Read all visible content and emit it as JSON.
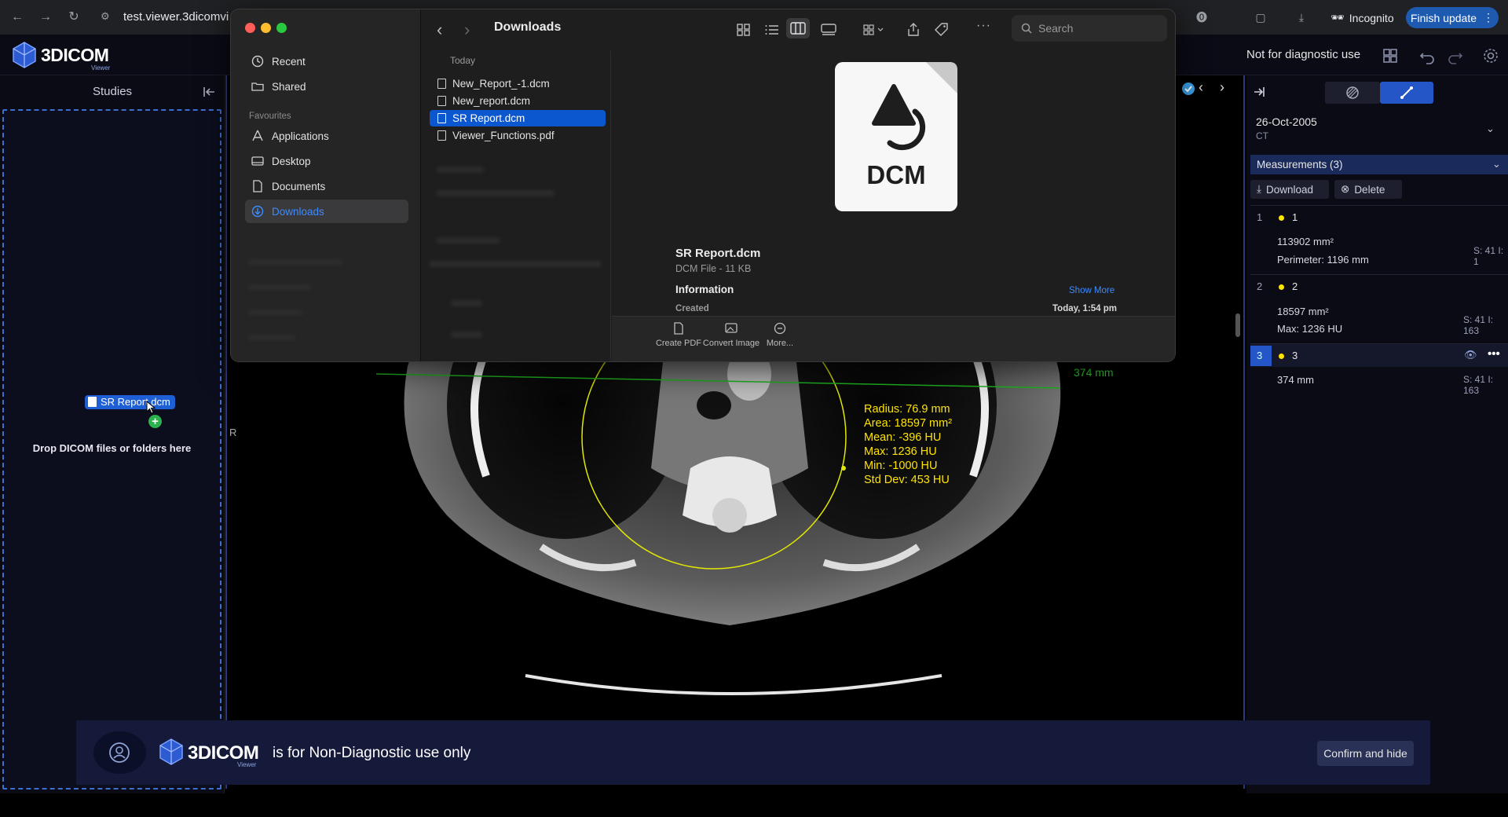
{
  "browser": {
    "url": "test.viewer.3dicomvi",
    "incognito_label": "Incognito",
    "update_label": "Finish update"
  },
  "header": {
    "brand": "3DICOM",
    "brand_sub": "Viewer",
    "notice": "Not for diagnostic use"
  },
  "left_panel": {
    "title": "Studies",
    "drop_text": "Drop DICOM files or folders here",
    "drag_file": "SR Report.dcm"
  },
  "viewer": {
    "orientation_left": "R",
    "line_measurement": "374 mm",
    "roi_stats": [
      "Radius: 76.9 mm",
      "Area: 18597 mm²",
      "Mean: -396 HU",
      "Max: 1236 HU",
      "Min: -1000 HU",
      "Std Dev: 453 HU"
    ]
  },
  "right_panel": {
    "study_date": "26-Oct-2005",
    "modality": "CT",
    "measurements_header": "Measurements (3)",
    "download_label": "Download",
    "delete_label": "Delete",
    "measurements": [
      {
        "index": "1",
        "name": "1",
        "values": [
          "113902 mm²",
          "Perimeter: 1196 mm"
        ],
        "slice": "S: 41 I: 1"
      },
      {
        "index": "2",
        "name": "2",
        "values": [
          "18597 mm²",
          "Max: 1236 HU"
        ],
        "slice": "S: 41 I: 163"
      },
      {
        "index": "3",
        "name": "3",
        "values": [
          "374 mm"
        ],
        "slice": "S: 41 I: 163"
      }
    ],
    "accent": "#ffe400"
  },
  "banner": {
    "brand": "3DICOM",
    "brand_sub": "Viewer",
    "text": "is for Non-Diagnostic use only",
    "confirm_label": "Confirm and hide"
  },
  "finder": {
    "title": "Downloads",
    "search_placeholder": "Search",
    "sidebar": {
      "items_top": [
        {
          "label": "Recent",
          "icon": "clock-icon"
        },
        {
          "label": "Shared",
          "icon": "shared-folder-icon"
        }
      ],
      "favourites_label": "Favourites",
      "favourites": [
        {
          "label": "Applications",
          "icon": "applications-icon"
        },
        {
          "label": "Desktop",
          "icon": "desktop-icon"
        },
        {
          "label": "Documents",
          "icon": "document-icon"
        },
        {
          "label": "Downloads",
          "icon": "download-circle-icon"
        }
      ]
    },
    "section_label": "Today",
    "files": [
      {
        "name": "New_Report_-1.dcm"
      },
      {
        "name": "New_report.dcm"
      },
      {
        "name": "SR Report.dcm"
      },
      {
        "name": "Viewer_Functions.pdf"
      }
    ],
    "preview": {
      "icon_text": "DCM",
      "name": "SR Report.dcm",
      "kind": "DCM File - 11 KB",
      "info_label": "Information",
      "show_more": "Show More",
      "created_label": "Created",
      "created_value": "Today, 1:54 pm",
      "actions": [
        "Create PDF",
        "Convert Image",
        "More..."
      ]
    }
  }
}
